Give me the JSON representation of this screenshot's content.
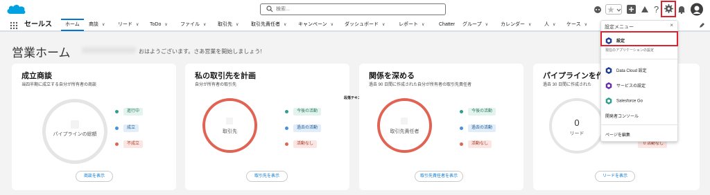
{
  "search": {
    "placeholder": "検索..."
  },
  "nav": {
    "app_name": "セールス",
    "tabs": [
      {
        "label": "ホーム",
        "active": true
      },
      {
        "label": "商談"
      },
      {
        "label": "リード"
      },
      {
        "label": "ToDo"
      },
      {
        "label": "ファイル"
      },
      {
        "label": "取引先"
      },
      {
        "label": "取引先責任者"
      },
      {
        "label": "キャンペーン"
      },
      {
        "label": "ダッシュボード"
      },
      {
        "label": "レポート"
      },
      {
        "label": "Chatter"
      },
      {
        "label": "グループ"
      },
      {
        "label": "カレンダー"
      },
      {
        "label": "人"
      },
      {
        "label": "ケース"
      }
    ]
  },
  "page": {
    "title": "営業ホーム",
    "greeting": "おはようございます。さあ営業を開始しましょう!"
  },
  "cards": [
    {
      "title": "成立商談",
      "subtitle": "当四半期に成立する自分が所有者の商談",
      "center": "パイプラインの総額",
      "legend": [
        "進行中",
        "成立",
        "不成立"
      ],
      "button": "商談を表示"
    },
    {
      "title": "私の取引先を計画",
      "subtitle": "自分が所有者の取引先",
      "center": "取引先",
      "legend": [
        "今後の活動",
        "過去の活動",
        "活動なし"
      ],
      "button": "取引先を表示"
    },
    {
      "title": "関係を深める",
      "subtitle": "過去 90 日間に作成された自分が所有者の取引先責任者",
      "center": "取引先責任者",
      "legend": [
        "今後の活動",
        "過去の活動",
        "活動なし"
      ],
      "button": "取引先責任者を表示"
    },
    {
      "title": "パイプラインを作",
      "subtitle": "過去 30 日間に作成された",
      "center_value": "0",
      "center": "リード",
      "legend_partial": "0 活動なし",
      "button": "リードを表示"
    }
  ],
  "paragraph_text": "段落テキスト",
  "setup_menu": {
    "title": "設定メニュー",
    "close": "×",
    "setup": "設定",
    "setup_sub": "現在のアプリケーションの設定",
    "items": [
      "Data Cloud 設定",
      "サービスの設定",
      "Salesforce Go"
    ],
    "dev_console": "開発者コンソール",
    "edit_page": "ページを編集"
  },
  "colors": {
    "accent": "#0176d3",
    "legend_green": "#2e9e8e",
    "legend_blue": "#4a90d9",
    "legend_red": "#e06353",
    "ring_red": "#e06353",
    "highlight": "#e0202a"
  }
}
